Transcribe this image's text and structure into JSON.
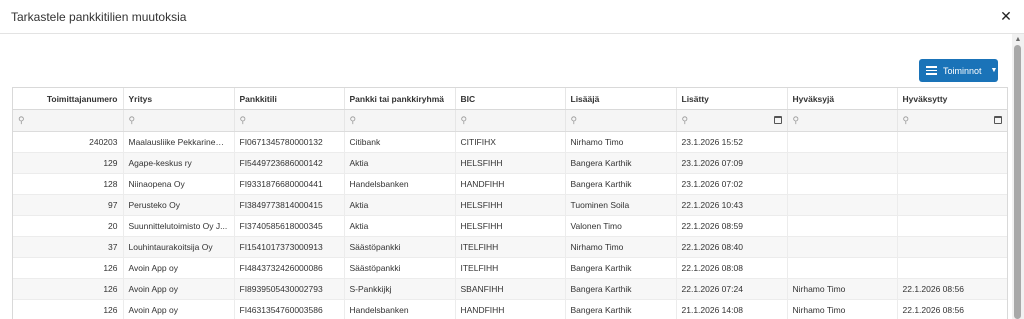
{
  "dialog": {
    "title": "Tarkastele pankkitilien muutoksia"
  },
  "toolbar": {
    "actions_label": "Toiminnot"
  },
  "icons": {
    "close": "close-icon",
    "menu": "hamburger-icon",
    "search": "search-icon",
    "calendar": "calendar-icon"
  },
  "colors": {
    "accent": "#1a73b8"
  },
  "table": {
    "columns": [
      "Toimittajanumero",
      "Yritys",
      "Pankkitili",
      "Pankki tai pankkiryhmä",
      "BIC",
      "Lisääjä",
      "Lisätty",
      "Hyväksyjä",
      "Hyväksytty"
    ],
    "rows": [
      [
        "240203",
        "Maalausliike Pekkarinen ...",
        "FI0671345780000132",
        "Citibank",
        "CITIFIHX",
        "Nirhamo Timo",
        "23.1.2026 15:52",
        "",
        ""
      ],
      [
        "129",
        "Agape-keskus ry",
        "FI5449723686000142",
        "Aktia",
        "HELSFIHH",
        "Bangera Karthik",
        "23.1.2026 07:09",
        "",
        ""
      ],
      [
        "128",
        "Niinaopena Oy",
        "FI9331876680000441",
        "Handelsbanken",
        "HANDFIHH",
        "Bangera Karthik",
        "23.1.2026 07:02",
        "",
        ""
      ],
      [
        "97",
        "Perusteko Oy",
        "FI3849773814000415",
        "Aktia",
        "HELSFIHH",
        "Tuominen Soila",
        "22.1.2026 10:43",
        "",
        ""
      ],
      [
        "20",
        "Suunnittelutoimisto Oy J...",
        "FI3740585618000345",
        "Aktia",
        "HELSFIHH",
        "Valonen Timo",
        "22.1.2026 08:59",
        "",
        ""
      ],
      [
        "37",
        "Louhintaurakoitsija Oy",
        "FI1541017373000913",
        "Säästöpankki",
        "ITELFIHH",
        "Nirhamo Timo",
        "22.1.2026 08:40",
        "",
        ""
      ],
      [
        "126",
        "Avoin App oy",
        "FI4843732426000086",
        "Säästöpankki",
        "ITELFIHH",
        "Bangera Karthik",
        "22.1.2026 08:08",
        "",
        ""
      ],
      [
        "126",
        "Avoin App oy",
        "FI8939505430002793",
        "S-Pankkijkj",
        "SBANFIHH",
        "Bangera Karthik",
        "22.1.2026 07:24",
        "Nirhamo Timo",
        "22.1.2026 08:56"
      ],
      [
        "126",
        "Avoin App oy",
        "FI4631354760003586",
        "Handelsbanken",
        "HANDFIHH",
        "Bangera Karthik",
        "21.1.2026 14:08",
        "Nirhamo Timo",
        "22.1.2026 08:56"
      ]
    ]
  }
}
